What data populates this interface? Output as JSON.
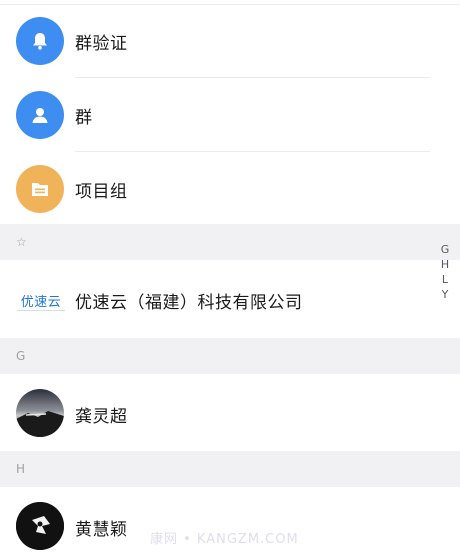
{
  "list": {
    "groups": [
      {
        "label": "群验证",
        "icon": "bell-icon",
        "color": "#3d8ef0"
      },
      {
        "label": "群",
        "icon": "person-icon",
        "color": "#3d8ef0"
      },
      {
        "label": "项目组",
        "icon": "folder-icon",
        "color": "#f0b35a"
      }
    ],
    "sections": [
      {
        "letter": "☆",
        "items": [
          {
            "logo_text": "优速云",
            "label": "优速云（福建）科技有限公司"
          }
        ]
      },
      {
        "letter": "G",
        "items": [
          {
            "label": "龚灵超",
            "avatar": "landscape-photo"
          }
        ]
      },
      {
        "letter": "H",
        "items": [
          {
            "label": "黄慧颖",
            "avatar": "flower-photo"
          }
        ]
      }
    ]
  },
  "index_bar": [
    "G",
    "H",
    "L",
    "Y"
  ],
  "watermark": "康网 • KANGZM.COM"
}
